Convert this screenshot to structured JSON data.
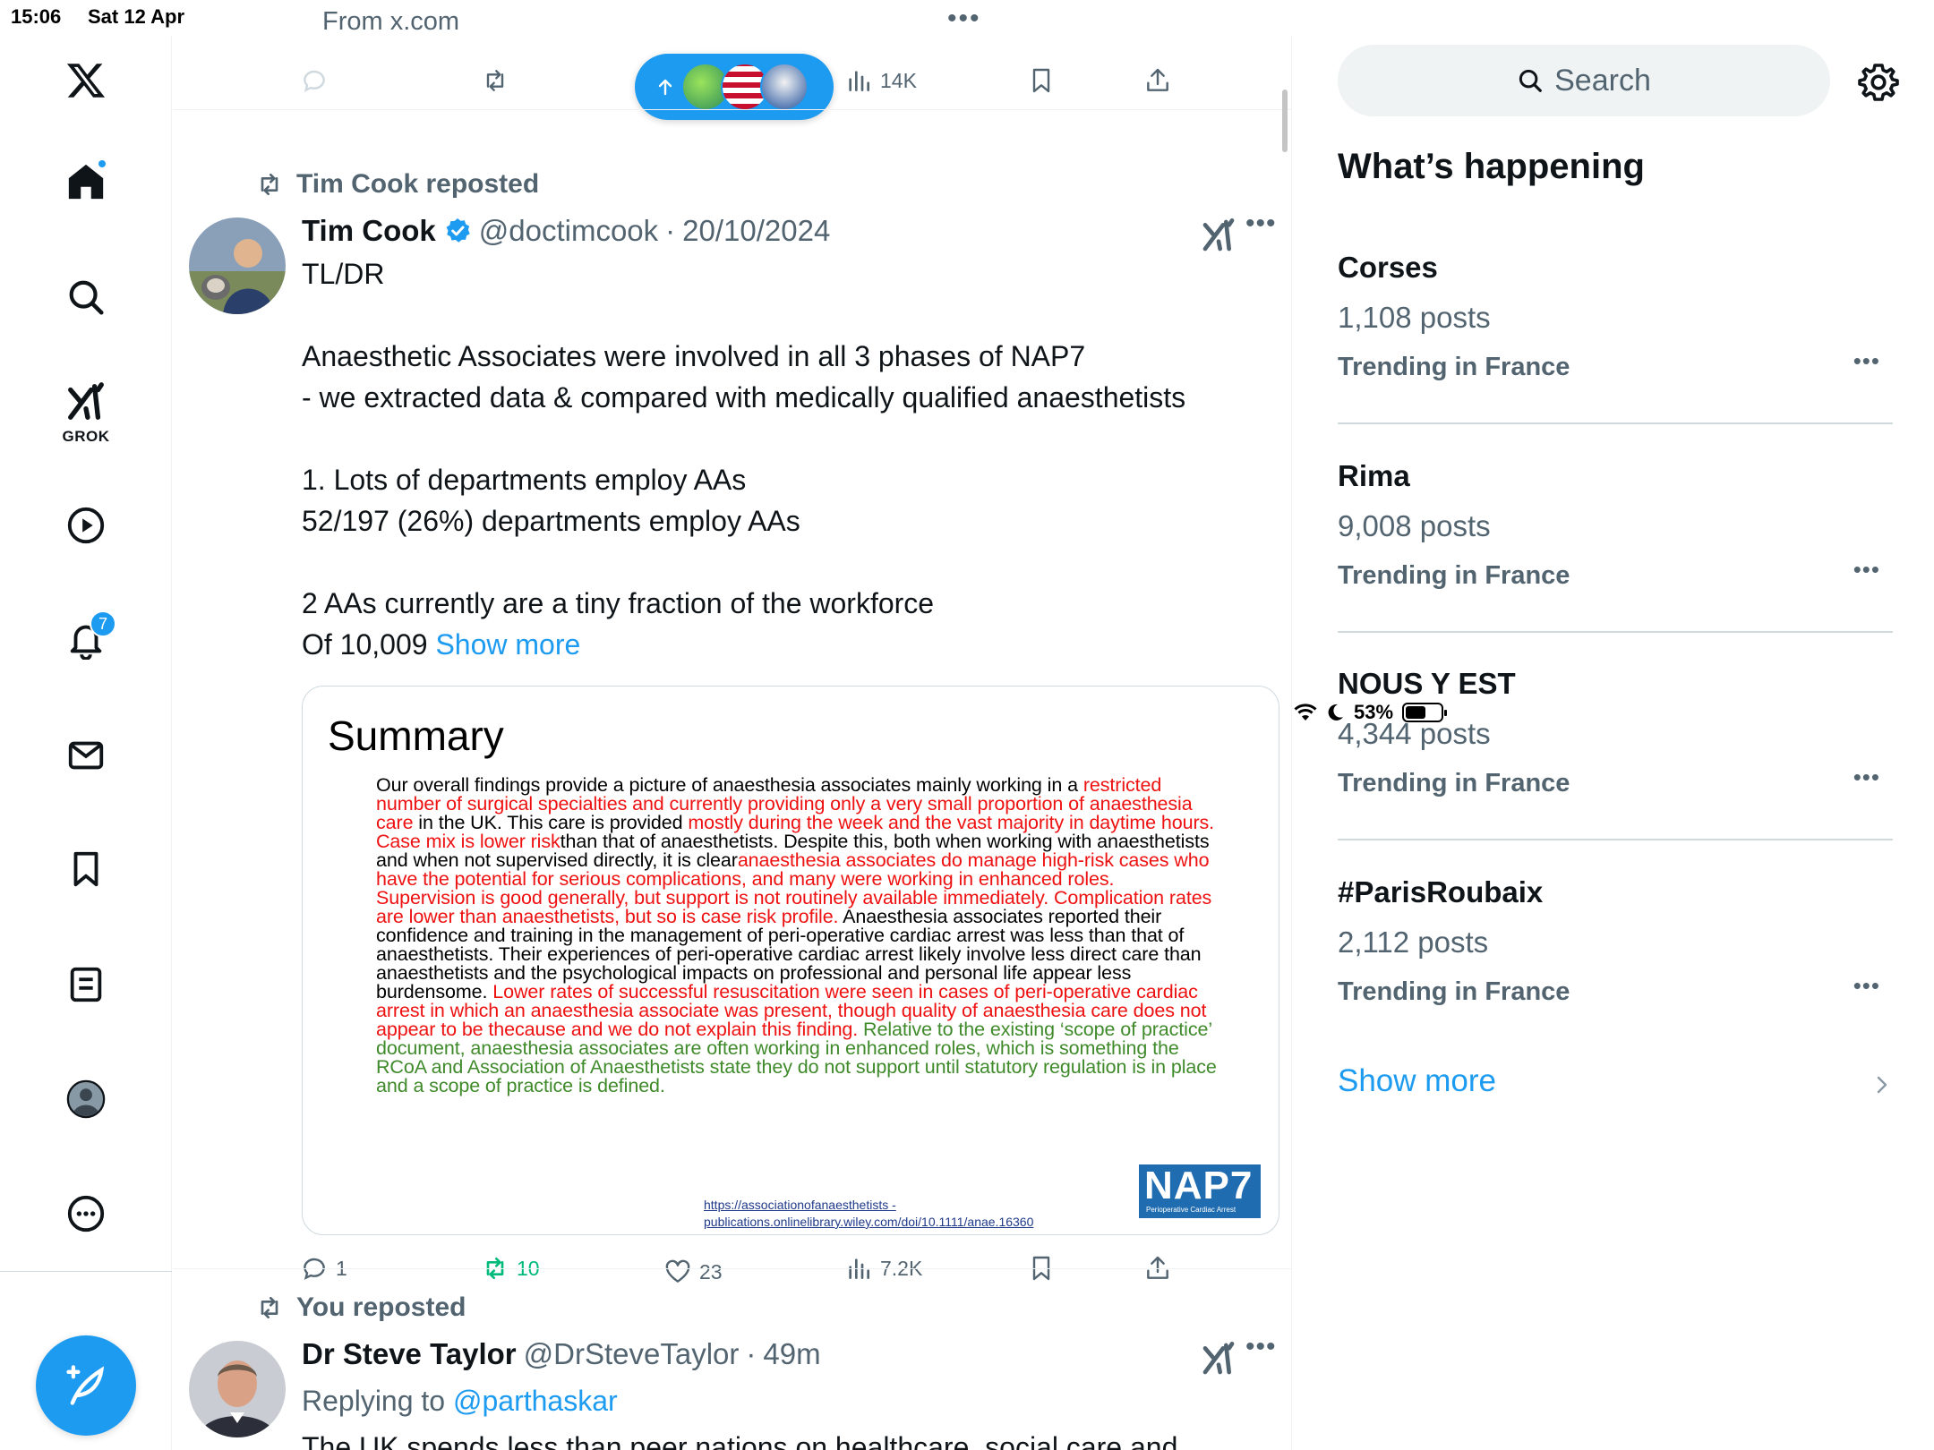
{
  "status_bar": {
    "time": "15:06",
    "date": "Sat 12 Apr",
    "source": "From x.com",
    "battery": "53%"
  },
  "nav": {
    "grok_label": "GROK",
    "notifications_badge": "7",
    "items": [
      "x-logo",
      "home",
      "search",
      "grok",
      "video",
      "notifications",
      "messages",
      "bookmarks",
      "lists",
      "profile",
      "more"
    ]
  },
  "top_actions": {
    "views": "14K"
  },
  "tweet1": {
    "repost_label": "Tim Cook reposted",
    "name": "Tim Cook",
    "handle": "@doctimcook",
    "sep": "·",
    "date": "20/10/2024",
    "text": "TL/DR\n\nAnaesthetic Associates were involved in all 3 phases of NAP7\n- we extracted data & compared with medically qualified anaesthetists\n\n1. Lots of departments employ AAs\n52/197 (26%) departments employ AAs\n\n2 AAs currently are a tiny fraction of the workforce\nOf 10,009",
    "show_more": "Show more",
    "summary": {
      "title": "Summary",
      "segments": [
        {
          "c": "k",
          "t": "Our overall findings provide a picture of anaesthesia associates mainly working in a "
        },
        {
          "c": "r",
          "t": "restricted number of surgical specialties and currently providing only a very small proportion of anaesthesia care"
        },
        {
          "c": "k",
          "t": " in the UK. This care is provided "
        },
        {
          "c": "r",
          "t": "mostly during the week and the vast majority in daytime hours. Case mix is lower risk"
        },
        {
          "c": "k",
          "t": "than that of anaesthetists. Despite this, both when working with anaesthetists and when not supervised directly, it is clear"
        },
        {
          "c": "r",
          "t": "anaesthesia associates do manage high-risk cases who have the potential for serious complications, and many were working in enhanced roles. Supervision is good generally, but support is not routinely available immediately. Complication rates are lower than anaesthetists, but so is case risk profile."
        },
        {
          "c": "k",
          "t": " Anaesthesia associates reported their confidence and training in the management of peri-operative cardiac arrest was less than that of anaesthetists. Their experiences of peri-operative cardiac arrest likely involve less direct care than anaesthetists and the psychological impacts on professional and personal life appear less burdensome. "
        },
        {
          "c": "r",
          "t": "Lower rates of successful resuscitation were seen in cases of peri-operative cardiac arrest in which an anaesthesia associate was present, though quality of anaesthesia care does not appear to be thecause and we do not explain this finding."
        },
        {
          "c": "g",
          "t": " Relative to the existing ‘scope of practice’ document, anaesthesia associates are often working in enhanced roles, which is something the RCoA and Association of Anaesthetists state they do not support until statutory regulation is in place and a scope of practice is defined."
        }
      ],
      "link_line1": "https://associationofanaesthetists -",
      "link_line2": "publications.onlinelibrary.wiley.com/doi/10.1111/anae.16360",
      "logo_text": "NAP7",
      "logo_sub": "Perioperative Cardiac Arrest"
    },
    "replies": "1",
    "reposts": "10",
    "likes": "23",
    "views": "7.2K"
  },
  "tweet2": {
    "repost_label": "You reposted",
    "name": "Dr Steve Taylor",
    "handle": "@DrSteveTaylor",
    "sep": "·",
    "time": "49m",
    "replying_prefix": "Replying to ",
    "replying_to": "@parthaskar",
    "text_partial": "The UK spends less than peer nations on healthcare, social care and"
  },
  "sidebar": {
    "search_placeholder": "Search",
    "section_title": "What’s happening",
    "trends": [
      {
        "name": "Corses",
        "count": "1,108 posts",
        "context": "Trending in France"
      },
      {
        "name": "Rima",
        "count": "9,008 posts",
        "context": "Trending in France"
      },
      {
        "name": "NOUS Y EST",
        "count": "4,344 posts",
        "context": "Trending in France"
      },
      {
        "name": "#ParisRoubaix",
        "count": "2,112 posts",
        "context": "Trending in France"
      }
    ],
    "show_more": "Show more"
  },
  "colors": {
    "accent": "#1d9bf0",
    "text": "#0f1419",
    "muted": "#536471",
    "repost_green": "#00ba7c",
    "summary_red": "#ee1111",
    "summary_green": "#3f8a2a"
  }
}
